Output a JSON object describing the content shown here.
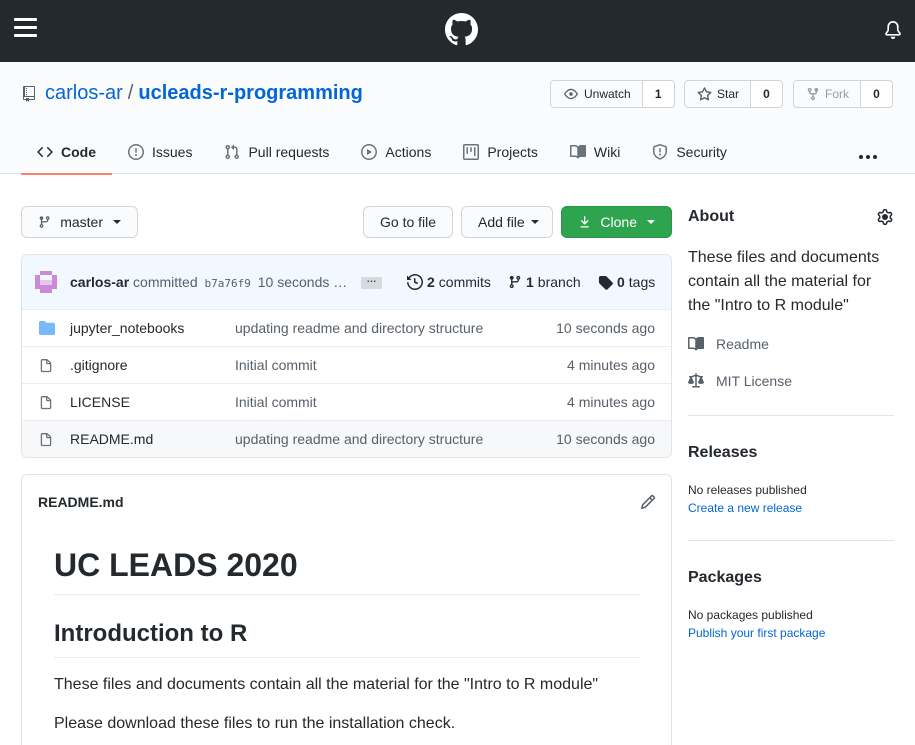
{
  "header": {
    "menu_icon": "hamburger-icon",
    "logo_icon": "github-logo-icon",
    "notifications_icon": "bell-icon"
  },
  "repo": {
    "owner": "carlos-ar",
    "separator": "/",
    "name": "ucleads-r-programming",
    "watch_label": "Unwatch",
    "watch_count": "1",
    "star_label": "Star",
    "star_count": "0",
    "fork_label": "Fork",
    "fork_count": "0"
  },
  "tabs": [
    {
      "label": "Code",
      "icon": "code-icon",
      "active": true
    },
    {
      "label": "Issues",
      "icon": "issue-icon"
    },
    {
      "label": "Pull requests",
      "icon": "pull-request-icon"
    },
    {
      "label": "Actions",
      "icon": "play-icon"
    },
    {
      "label": "Projects",
      "icon": "project-icon"
    },
    {
      "label": "Wiki",
      "icon": "book-icon"
    },
    {
      "label": "Security",
      "icon": "shield-icon"
    }
  ],
  "toolbar": {
    "branch_label": "master",
    "go_to_file": "Go to file",
    "add_file": "Add file",
    "clone": "Clone"
  },
  "commit": {
    "author": "carlos-ar",
    "verb": "committed",
    "sha": "b7a76f9",
    "time": "10 seconds …",
    "ellipsis": "…",
    "commits_count": "2",
    "commits_label": "commits",
    "branch_count": "1",
    "branch_label": "branch",
    "tags_count": "0",
    "tags_label": "tags"
  },
  "files": [
    {
      "name": "jupyter_notebooks",
      "type": "folder",
      "message": "updating readme and directory structure",
      "age": "10 seconds ago"
    },
    {
      "name": ".gitignore",
      "type": "file",
      "message": "Initial commit",
      "age": "4 minutes ago"
    },
    {
      "name": "LICENSE",
      "type": "file",
      "message": "Initial commit",
      "age": "4 minutes ago"
    },
    {
      "name": "README.md",
      "type": "file",
      "message": "updating readme and directory structure",
      "age": "10 seconds ago"
    }
  ],
  "readme": {
    "filename": "README.md",
    "h1": "UC LEADS 2020",
    "h2": "Introduction to R",
    "p1": "These files and documents contain all the material for the \"Intro to R module\"",
    "p2": "Please download these files to run the installation check."
  },
  "about": {
    "title": "About",
    "description": "These files and documents contain all the material for the \"Intro to R module\"",
    "readme_link": "Readme",
    "license_link": "MIT License"
  },
  "releases": {
    "title": "Releases",
    "empty_text": "No releases published",
    "create_link": "Create a new release"
  },
  "packages": {
    "title": "Packages",
    "empty_text": "No packages published",
    "publish_link": "Publish your first package"
  },
  "colors": {
    "header_bg": "#24292e",
    "link_blue": "#0366d6",
    "green_button": "#2ea44f",
    "active_tab_underline": "#f9826c",
    "folder_blue": "#79b8ff"
  }
}
